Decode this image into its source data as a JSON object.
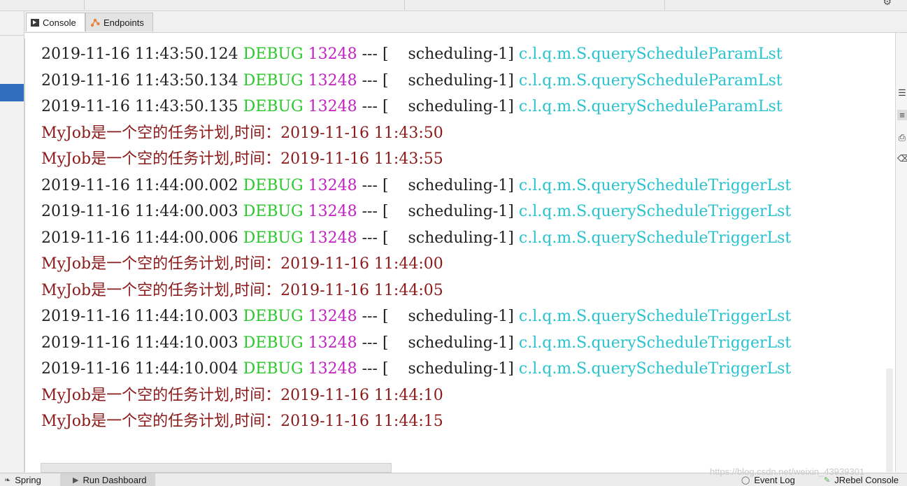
{
  "tabs": [
    {
      "label": "Console",
      "icon": "console-icon",
      "active": true
    },
    {
      "label": "Endpoints",
      "icon": "endpoints-icon",
      "active": false
    }
  ],
  "log_lines": [
    {
      "type": "debug",
      "timestamp": "2019-11-16 11:43:50.124",
      "level": "DEBUG",
      "pid": "13248",
      "sep": "---",
      "thread": "[    scheduling-1]",
      "logger": "c.l.q.m.S.queryScheduleParamLst"
    },
    {
      "type": "debug",
      "timestamp": "2019-11-16 11:43:50.134",
      "level": "DEBUG",
      "pid": "13248",
      "sep": "---",
      "thread": "[    scheduling-1]",
      "logger": "c.l.q.m.S.queryScheduleParamLst"
    },
    {
      "type": "debug",
      "timestamp": "2019-11-16 11:43:50.135",
      "level": "DEBUG",
      "pid": "13248",
      "sep": "---",
      "thread": "[    scheduling-1]",
      "logger": "c.l.q.m.S.queryScheduleParamLst"
    },
    {
      "type": "message",
      "text": "MyJob是一个空的任务计划,时间：2019-11-16 11:43:50"
    },
    {
      "type": "message",
      "text": "MyJob是一个空的任务计划,时间：2019-11-16 11:43:55"
    },
    {
      "type": "debug",
      "timestamp": "2019-11-16 11:44:00.002",
      "level": "DEBUG",
      "pid": "13248",
      "sep": "---",
      "thread": "[    scheduling-1]",
      "logger": "c.l.q.m.S.queryScheduleTriggerLst"
    },
    {
      "type": "debug",
      "timestamp": "2019-11-16 11:44:00.003",
      "level": "DEBUG",
      "pid": "13248",
      "sep": "---",
      "thread": "[    scheduling-1]",
      "logger": "c.l.q.m.S.queryScheduleTriggerLst"
    },
    {
      "type": "debug",
      "timestamp": "2019-11-16 11:44:00.006",
      "level": "DEBUG",
      "pid": "13248",
      "sep": "---",
      "thread": "[    scheduling-1]",
      "logger": "c.l.q.m.S.queryScheduleTriggerLst"
    },
    {
      "type": "message",
      "text": "MyJob是一个空的任务计划,时间：2019-11-16 11:44:00"
    },
    {
      "type": "message",
      "text": "MyJob是一个空的任务计划,时间：2019-11-16 11:44:05"
    },
    {
      "type": "debug",
      "timestamp": "2019-11-16 11:44:10.003",
      "level": "DEBUG",
      "pid": "13248",
      "sep": "---",
      "thread": "[    scheduling-1]",
      "logger": "c.l.q.m.S.queryScheduleTriggerLst"
    },
    {
      "type": "debug",
      "timestamp": "2019-11-16 11:44:10.003",
      "level": "DEBUG",
      "pid": "13248",
      "sep": "---",
      "thread": "[    scheduling-1]",
      "logger": "c.l.q.m.S.queryScheduleTriggerLst"
    },
    {
      "type": "debug",
      "timestamp": "2019-11-16 11:44:10.004",
      "level": "DEBUG",
      "pid": "13248",
      "sep": "---",
      "thread": "[    scheduling-1]",
      "logger": "c.l.q.m.S.queryScheduleTriggerLst"
    },
    {
      "type": "message",
      "text": "MyJob是一个空的任务计划,时间：2019-11-16 11:44:10"
    },
    {
      "type": "message",
      "text": "MyJob是一个空的任务计划,时间：2019-11-16 11:44:15"
    }
  ],
  "colors": {
    "timestamp": "#222222",
    "level": "#29c929",
    "pid": "#c221c2",
    "logger": "#28c3cf",
    "message": "#8b1a1a",
    "selection": "#2f6fbd"
  },
  "bottom_bar": [
    {
      "label": "Spring",
      "icon": "spring-icon",
      "active": false
    },
    {
      "label": "Run Dashboard",
      "icon": "run-dashboard-icon",
      "active": true
    },
    {
      "label": "Event Log",
      "icon": "event-log-icon",
      "active": false
    },
    {
      "label": "JRebel Console",
      "icon": "jrebel-icon",
      "active": false
    }
  ],
  "right_toolbar_icons": [
    "scroll-to-end-icon",
    "soft-wrap-icon",
    "print-icon",
    "clear-icon"
  ],
  "watermark": "https://blog.csdn.net/weixin_43939301"
}
